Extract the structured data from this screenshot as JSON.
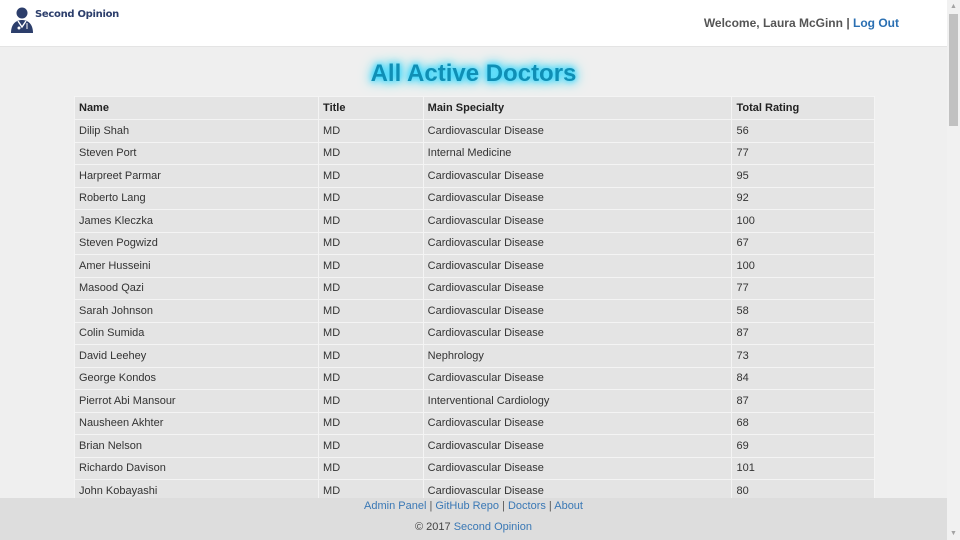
{
  "header": {
    "logo_text": "Second Opinion",
    "welcome_text": "Welcome, Laura McGinn",
    "separator": "|",
    "logout_label": "Log Out"
  },
  "title": "All Active Doctors",
  "table": {
    "columns": [
      "Name",
      "Title",
      "Main Specialty",
      "Total Rating"
    ],
    "rows": [
      [
        "Dilip Shah",
        "MD",
        "Cardiovascular Disease",
        "56"
      ],
      [
        "Steven Port",
        "MD",
        "Internal Medicine",
        "77"
      ],
      [
        "Harpreet Parmar",
        "MD",
        "Cardiovascular Disease",
        "95"
      ],
      [
        "Roberto Lang",
        "MD",
        "Cardiovascular Disease",
        "92"
      ],
      [
        "James Kleczka",
        "MD",
        "Cardiovascular Disease",
        "100"
      ],
      [
        "Steven Pogwizd",
        "MD",
        "Cardiovascular Disease",
        "67"
      ],
      [
        "Amer Husseini",
        "MD",
        "Cardiovascular Disease",
        "100"
      ],
      [
        "Masood Qazi",
        "MD",
        "Cardiovascular Disease",
        "77"
      ],
      [
        "Sarah Johnson",
        "MD",
        "Cardiovascular Disease",
        "58"
      ],
      [
        "Colin Sumida",
        "MD",
        "Cardiovascular Disease",
        "87"
      ],
      [
        "David Leehey",
        "MD",
        "Nephrology",
        "73"
      ],
      [
        "George Kondos",
        "MD",
        "Cardiovascular Disease",
        "84"
      ],
      [
        "Pierrot Abi Mansour",
        "MD",
        "Interventional Cardiology",
        "87"
      ],
      [
        "Nausheen Akhter",
        "MD",
        "Cardiovascular Disease",
        "68"
      ],
      [
        "Brian Nelson",
        "MD",
        "Cardiovascular Disease",
        "69"
      ],
      [
        "Richardo Davison",
        "MD",
        "Cardiovascular Disease",
        "101"
      ],
      [
        "John Kobayashi",
        "MD",
        "Cardiovascular Disease",
        "80"
      ]
    ]
  },
  "footer": {
    "links": [
      "Admin Panel",
      "GitHub Repo",
      "Doctors",
      "About"
    ],
    "separator": "|",
    "copyright": "© 2017",
    "brand": "Second Opinion"
  },
  "colors": {
    "title": "#0f8fb5",
    "title_glow": "#1fd3ff",
    "link": "#2a6fb2",
    "table_bg": "#e4e4e4",
    "page_bg": "#efefef"
  },
  "icons": {
    "logo": "doctor-silhouette-icon",
    "scroll_up": "triangle-up",
    "scroll_down": "triangle-down"
  }
}
